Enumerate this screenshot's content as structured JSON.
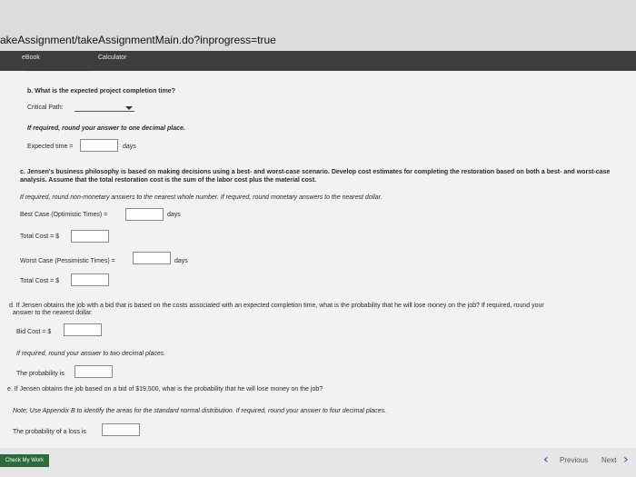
{
  "browser": {
    "url": "akeAssignment/takeAssignmentMain.do?inprogress=true"
  },
  "tabs": {
    "ebook": "eBook",
    "calculator": "Calculator"
  },
  "part_b": {
    "question": "b. What is the expected project completion time?",
    "critical_path_label": "Critical Path:",
    "round_note": "If required, round your answer to one decimal place.",
    "expected_time_label": "Expected time =",
    "expected_time_value": "",
    "expected_time_unit": "days"
  },
  "part_c": {
    "question_line1": "c. Jensen's business philosophy is based on making decisions using a best- and worst-case scenario. Develop cost estimates for completing the restoration based on both a best- and worst-case",
    "question_line2": "analysis. Assume that the total restoration cost is the sum of the labor cost plus the material cost.",
    "round_note": "If required, round non-monetary answers to the nearest whole number. If required, round monetary answers to the nearest dollar.",
    "best_case_label": "Best Case (Optimistic Times) =",
    "best_case_unit": "days",
    "best_total_cost_label": "Total Cost = $",
    "worst_case_label": "Worst Case (Pessimistic Times) =",
    "worst_case_unit": "days",
    "worst_total_cost_label": "Total Cost = $"
  },
  "part_d": {
    "question_line1": "d. If Jensen obtains the job with a bid that is based on the costs associated with an expected completion time, what is the probability that he will lose money on the job? If required, round your",
    "question_line2": "answer to the nearest dollar.",
    "bid_cost_label": "Bid Cost = $",
    "round_note": "If required, round your answer to two decimal places.",
    "probability_label": "The probability is"
  },
  "part_e": {
    "question": "e. If Jensen obtains the job based on a bid of $19,500, what is the probability that he will lose money on the job?",
    "note": "Note: Use Appendix B to identify the areas for the standard normal distribution. If required, round your answer to four decimal places.",
    "probability_label": "The probability of a loss is"
  },
  "footer": {
    "check_button": "Check My Work",
    "previous": "Previous",
    "next": "Next"
  }
}
